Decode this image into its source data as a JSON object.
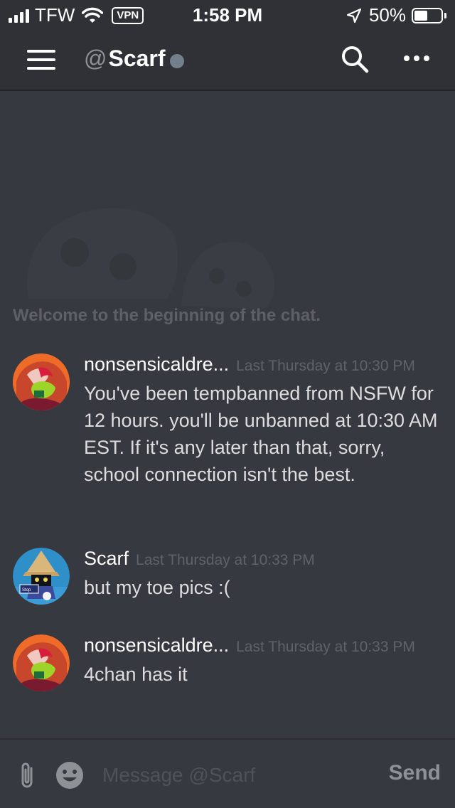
{
  "status_bar": {
    "carrier": "TFW",
    "vpn": "VPN",
    "time": "1:58 PM",
    "battery_pct": "50%",
    "battery_level": 0.5
  },
  "header": {
    "at_symbol": "@",
    "title": "Scarf",
    "presence_color": "#747f8d"
  },
  "welcome": "Welcome to the beginning of the chat.",
  "messages": [
    {
      "author": "nonsensicaldre...",
      "timestamp": "Last Thursday at 10:30 PM",
      "text": "You've been tempbanned from NSFW for 12 hours. you'll be unbanned at 10:30 AM EST. If it's any later than that, sorry, school connection isn't the best."
    },
    {
      "author": "Scarf",
      "timestamp": "Last Thursday at 10:33 PM",
      "text": "but my toe pics :("
    },
    {
      "author": "nonsensicaldre...",
      "timestamp": "Last Thursday at 10:33 PM",
      "text": "4chan has it"
    }
  ],
  "avatar_sign_text": "Stop",
  "composer": {
    "placeholder": "Message @Scarf",
    "send_label": "Send"
  },
  "colors": {
    "background": "#36393f",
    "header": "#2f3136",
    "accent_white": "#ffffff",
    "muted": "#5f6368"
  },
  "icons": [
    "signal-icon",
    "wifi-icon",
    "location-arrow-icon",
    "battery-icon",
    "hamburger-menu-icon",
    "search-icon",
    "more-dots-icon",
    "paperclip-icon",
    "emoji-icon"
  ]
}
